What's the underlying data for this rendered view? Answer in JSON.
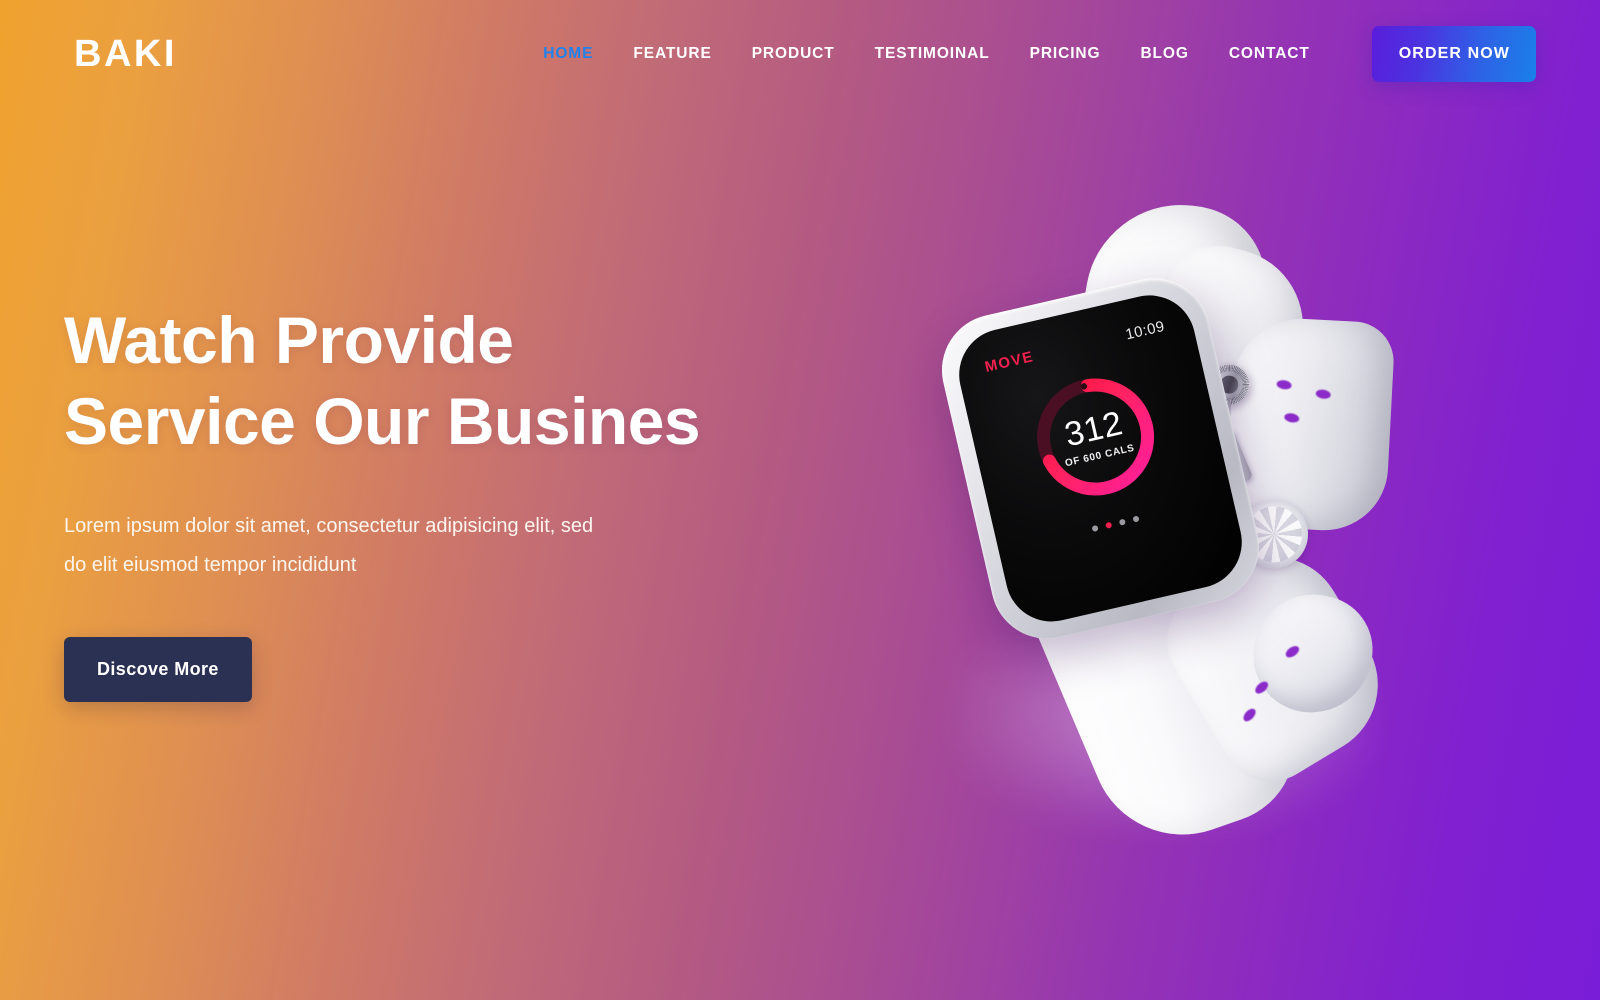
{
  "brand": {
    "logo": "BAKI"
  },
  "nav": {
    "items": [
      {
        "label": "HOME",
        "active": true
      },
      {
        "label": "FEATURE",
        "active": false
      },
      {
        "label": "PRODUCT",
        "active": false
      },
      {
        "label": "TESTIMOINAL",
        "active": false
      },
      {
        "label": "PRICING",
        "active": false
      },
      {
        "label": "BLOG",
        "active": false
      },
      {
        "label": "CONTACT",
        "active": false
      }
    ],
    "cta_label": "ORDER NOW"
  },
  "hero": {
    "headline_line1": "Watch Provide",
    "headline_line2": "Service Our Busines",
    "subcopy_line1": "Lorem ipsum dolor sit amet, consectetur adipisicing elit, sed",
    "subcopy_line2": "do elit eiusmod tempor incididunt",
    "cta_label": "Discove More"
  },
  "watch": {
    "screen": {
      "metric_label": "MOVE",
      "time": "10:09",
      "value": "312",
      "goal_label": "OF 600 CALS",
      "page_dots": 4,
      "active_dot_index": 1
    }
  },
  "colors": {
    "gradient_start": "#f0a22e",
    "gradient_mid": "#b45a82",
    "gradient_end": "#7a1dd8",
    "nav_active": "#1f82ef",
    "cta_dark": "#2b3152",
    "order_btn_start": "#5a1ddb",
    "order_btn_end": "#1a80e9",
    "watch_accent": "#f2204f",
    "watch_accent_2": "#ff1f6a"
  }
}
